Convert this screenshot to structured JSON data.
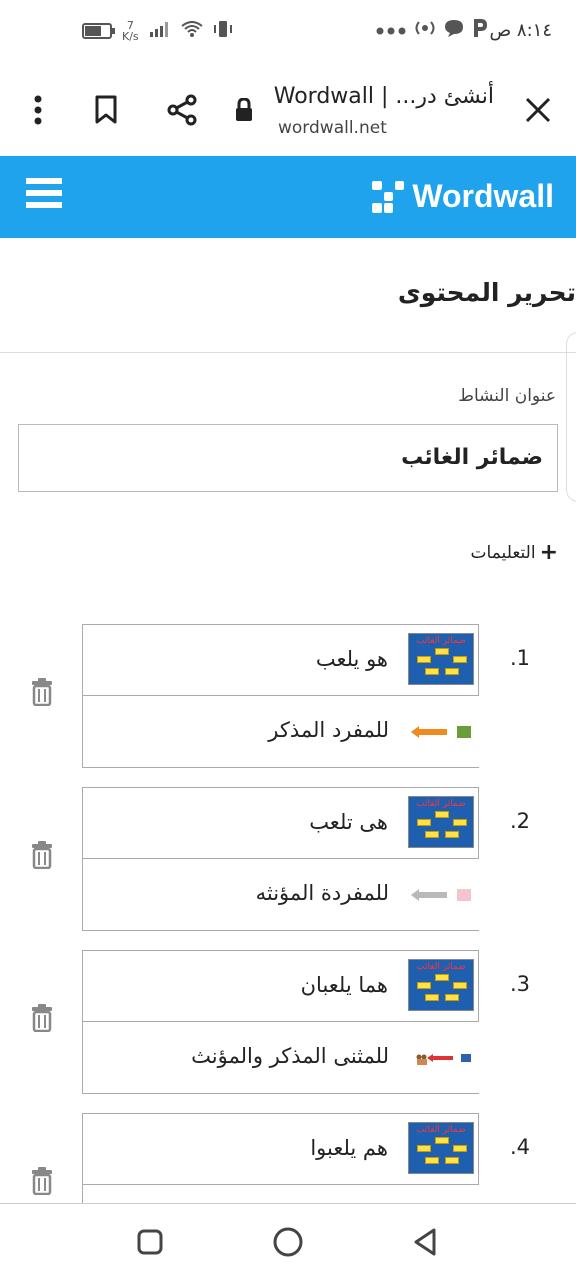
{
  "status_bar": {
    "time": "٨:١٤ ص",
    "net_speed_value": "7",
    "net_speed_unit": "K/s"
  },
  "browser": {
    "tab_title": "أنشئ در... | Wordwall",
    "url": "wordwall.net"
  },
  "header": {
    "logo_text": "Wordwall",
    "brand_color": "#1fa3ec"
  },
  "page": {
    "title": "تحرير المحتوى",
    "activity_title_label": "عنوان النشاط",
    "activity_title_value": "ضمائر الغائب",
    "instructions_label": "التعليمات"
  },
  "items": [
    {
      "num": ".1",
      "prompt": "هو يلعب",
      "answer": "للمفرد المذكر"
    },
    {
      "num": ".2",
      "prompt": "هى تلعب",
      "answer": "للمفردة المؤنثه"
    },
    {
      "num": ".3",
      "prompt": "هما يلعبان",
      "answer": "للمثنى المذكر والمؤنث"
    },
    {
      "num": ".4",
      "prompt": "هم يلعبوا",
      "answer": ""
    }
  ],
  "thumbnail": {
    "title": "ضمائر الغائب"
  }
}
